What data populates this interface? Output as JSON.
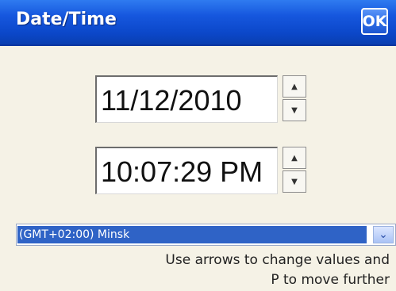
{
  "window": {
    "title": "Date/Time",
    "ok_label": "OK"
  },
  "date_field": {
    "value": "11/12/2010"
  },
  "time_field": {
    "value": "10:07:29 PM"
  },
  "timezone": {
    "selected": "(GMT+02:00) Minsk"
  },
  "hint": {
    "line1": "Use arrows to change values and",
    "line2": "P to move further"
  },
  "icons": {
    "spin_up": "spin-up-icon",
    "spin_down": "spin-down-icon",
    "dropdown": "chevron-down-icon"
  },
  "colors": {
    "titlebar": "#1657de",
    "selection": "#2f63c6",
    "background": "#f5f2e6"
  }
}
